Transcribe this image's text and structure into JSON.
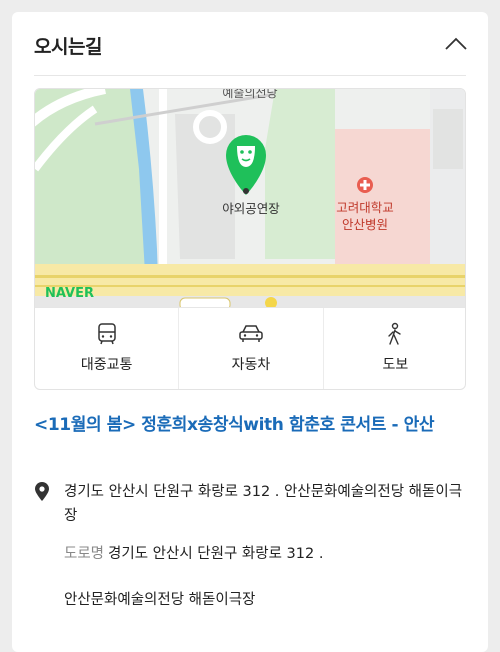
{
  "section": {
    "title": "오시는길"
  },
  "map": {
    "labels": {
      "top": "예술의전당",
      "venue": "야외공연장",
      "hospital_line1": "고려대학교",
      "hospital_line2": "안산병원",
      "provider": "NAVER"
    }
  },
  "transport": [
    {
      "label": "대중교통",
      "icon": "bus-icon"
    },
    {
      "label": "자동차",
      "icon": "car-icon"
    },
    {
      "label": "도보",
      "icon": "walk-icon"
    }
  ],
  "event": {
    "title": "<11월의 봄> 정훈희x송창식with 함춘호 콘서트 - 안산"
  },
  "address": {
    "full": "경기도 안산시 단원구 화랑로 312 . 안산문화예술의전당 해돋이극장",
    "road_tag": "도로명",
    "road": "경기도 안산시 단원구 화랑로 312 .",
    "road_line2": "안산문화예술의전당 해돋이극장"
  },
  "colors": {
    "accent": "#1a6bb8",
    "pin": "#1fc05a",
    "naver": "#1fc05a"
  }
}
